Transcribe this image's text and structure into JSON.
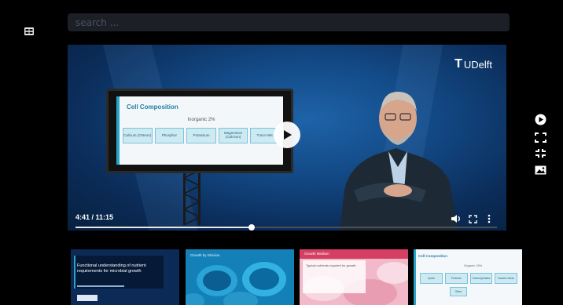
{
  "search": {
    "placeholder": "search ..."
  },
  "player": {
    "brand": {
      "mark": "T",
      "name": "UDelft"
    },
    "slide": {
      "title": "Cell Composition",
      "subtitle": "Inorganic 2%",
      "cells": [
        "Calcium (Osteon)",
        "Phosphor",
        "Potassium",
        "Magnesium (Calcium)",
        "Trace Met."
      ]
    },
    "time_label": "4:41 / 11:15",
    "progress_fraction": 0.417
  },
  "side_tools": [
    "play-icon",
    "fullscreen-icon",
    "exit-fullscreen-icon",
    "image-icon"
  ],
  "thumbnails": [
    {
      "title": "Functional understanding of nutrient requirements for microbial growth"
    },
    {
      "title": "Growth by Division"
    },
    {
      "title": "Growth Medium",
      "subtitle": "Typical nutrients required for growth"
    },
    {
      "title": "Cell Composition",
      "subtitle": "Organic 15%",
      "cells": [
        "Lipids",
        "Proteins",
        "Carbohydrates",
        "Nucleic Acids",
        "Other"
      ]
    }
  ],
  "colors": {
    "background": "#000000",
    "search_bg": "#1c1f26",
    "accent": "#2aa3c9"
  }
}
